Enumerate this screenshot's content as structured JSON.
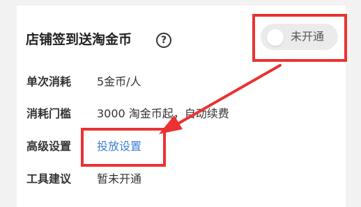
{
  "card": {
    "title": "店铺签到送淘金币",
    "help_icon_glyph": "?",
    "toggle": {
      "label": "未开通",
      "state": "off"
    }
  },
  "rows": [
    {
      "label": "单次消耗",
      "value": "5金币/人"
    },
    {
      "label": "消耗门槛",
      "value": "3000 淘金币起，自动续费"
    },
    {
      "label": "高级设置",
      "value": "投放设置"
    },
    {
      "label": "工具建议",
      "value": "暂未开通"
    }
  ],
  "colors": {
    "highlight": "#ea3232",
    "link": "#3c7fd8",
    "toggle_track": "#ebebeb"
  }
}
